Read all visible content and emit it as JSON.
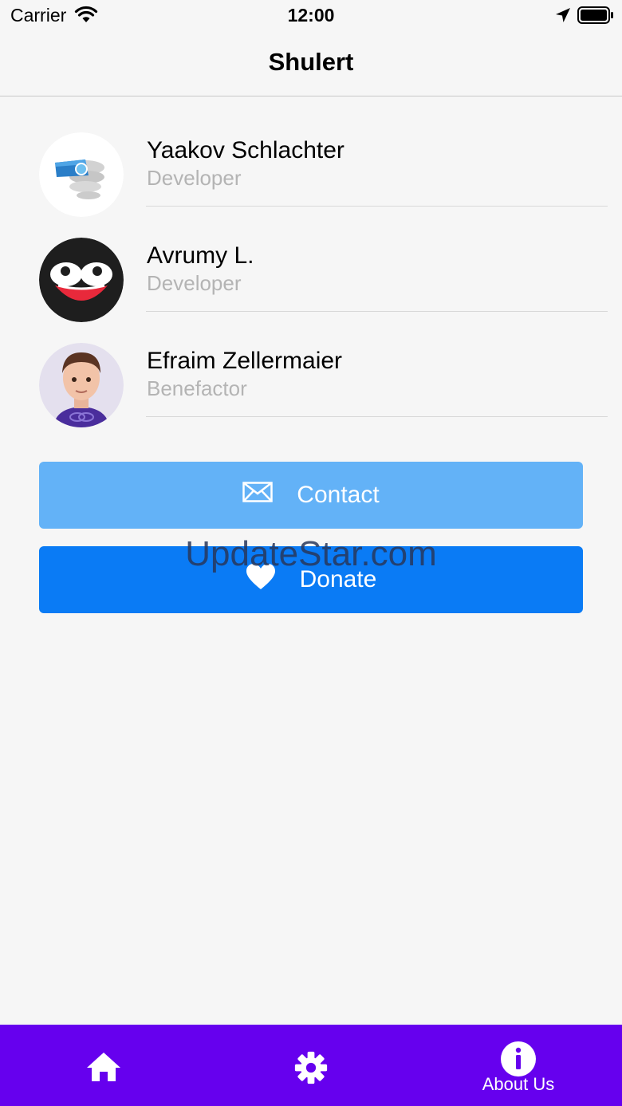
{
  "status_bar": {
    "carrier": "Carrier",
    "time": "12:00",
    "icons": [
      "wifi-icon",
      "location-arrow-icon",
      "battery-icon"
    ]
  },
  "nav": {
    "title": "Shulert"
  },
  "team": [
    {
      "name": "Yaakov Schlachter",
      "role": "Developer",
      "avatar": "hair-dryer-logo-avatar"
    },
    {
      "name": "Avrumy L.",
      "role": "Developer",
      "avatar": "cartoon-face-avatar"
    },
    {
      "name": "Efraim Zellermaier",
      "role": "Benefactor",
      "avatar": "memoji-avatar"
    }
  ],
  "buttons": {
    "contact_label": "Contact",
    "contact_icon": "envelope-icon",
    "donate_label": "Donate",
    "donate_icon": "heart-icon"
  },
  "watermark": "UpdateStar.com",
  "tab_bar": {
    "tabs": [
      {
        "icon": "home-icon",
        "label": ""
      },
      {
        "icon": "gear-icon",
        "label": ""
      },
      {
        "icon": "info-icon",
        "label": "About Us"
      }
    ]
  },
  "colors": {
    "background": "#f6f6f6",
    "contact_button": "#63b2f7",
    "donate_button": "#0a7bf5",
    "tab_bar": "#6600ee",
    "secondary_text": "#b4b4b4"
  }
}
